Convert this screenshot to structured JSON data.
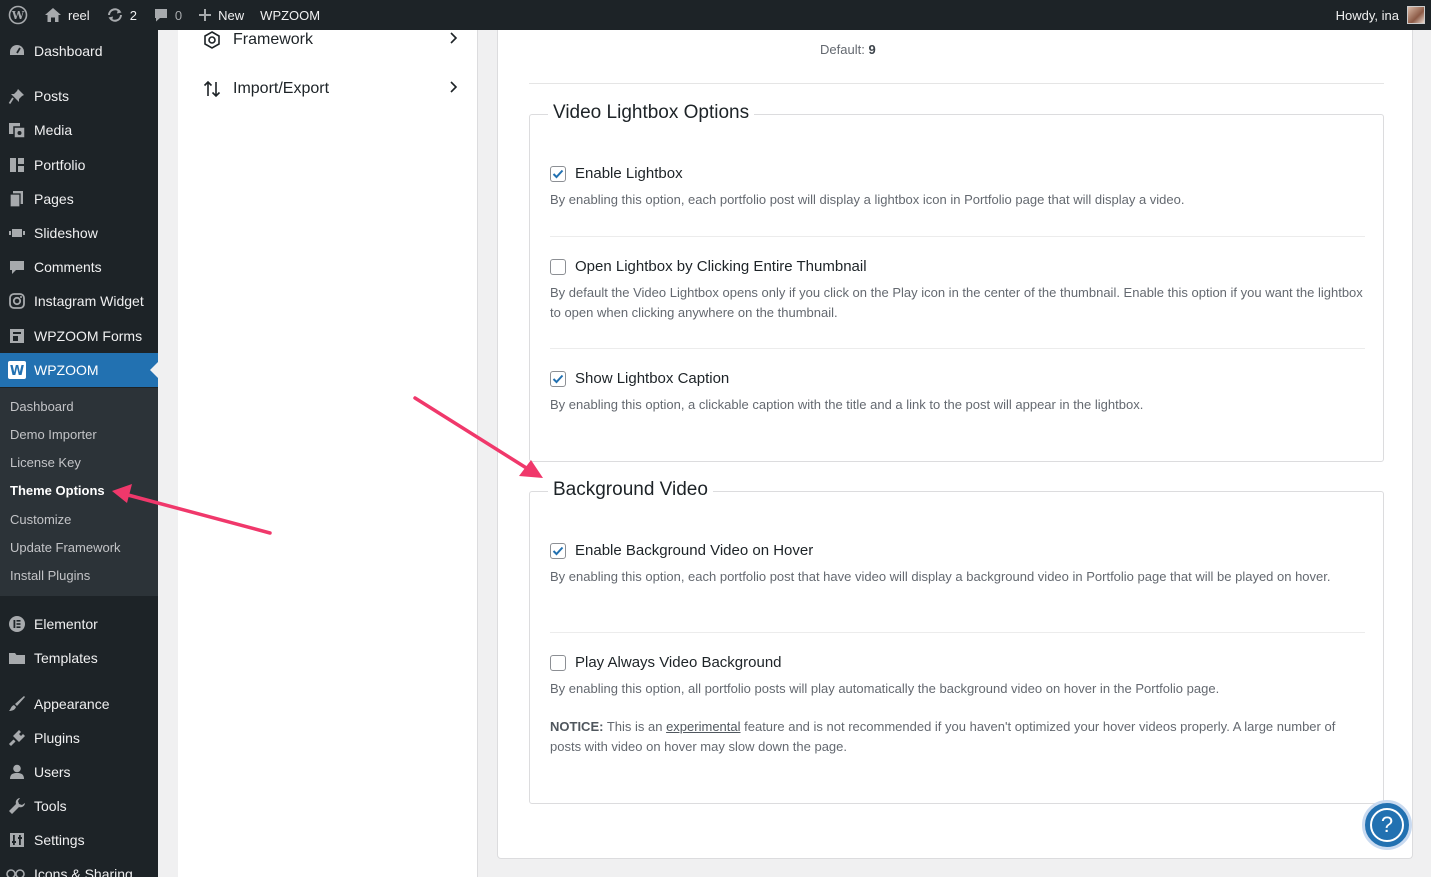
{
  "adminbar": {
    "site_name": "reel",
    "updates_count": "2",
    "comments_count": "0",
    "new_label": "New",
    "wpzoom_label": "WPZOOM",
    "howdy": "Howdy, ina"
  },
  "sidebar": {
    "items": [
      {
        "label": "Dashboard",
        "icon": "dashboard-icon"
      },
      {
        "label": "Posts",
        "icon": "pin-icon"
      },
      {
        "label": "Media",
        "icon": "media-icon"
      },
      {
        "label": "Portfolio",
        "icon": "portfolio-icon"
      },
      {
        "label": "Pages",
        "icon": "pages-icon"
      },
      {
        "label": "Slideshow",
        "icon": "slideshow-icon"
      },
      {
        "label": "Comments",
        "icon": "comments-icon"
      },
      {
        "label": "Instagram Widget",
        "icon": "instagram-icon"
      },
      {
        "label": "WPZOOM Forms",
        "icon": "forms-icon"
      },
      {
        "label": "WPZOOM",
        "icon": "wpzoom-icon"
      },
      {
        "label": "Elementor",
        "icon": "elementor-icon"
      },
      {
        "label": "Templates",
        "icon": "folder-icon"
      },
      {
        "label": "Appearance",
        "icon": "brush-icon"
      },
      {
        "label": "Plugins",
        "icon": "plugin-icon"
      },
      {
        "label": "Users",
        "icon": "user-icon"
      },
      {
        "label": "Tools",
        "icon": "wrench-icon"
      },
      {
        "label": "Settings",
        "icon": "settings-icon"
      },
      {
        "label": "Icons & Sharing",
        "icon": "share-icon"
      }
    ],
    "submenu": [
      {
        "label": "Dashboard"
      },
      {
        "label": "Demo Importer"
      },
      {
        "label": "License Key"
      },
      {
        "label": "Theme Options"
      },
      {
        "label": "Customize"
      },
      {
        "label": "Update Framework"
      },
      {
        "label": "Install Plugins"
      }
    ]
  },
  "options_nav": {
    "items": [
      {
        "label": "Framework",
        "icon": "framework-icon"
      },
      {
        "label": "Import/Export",
        "icon": "import-export-icon"
      }
    ]
  },
  "main": {
    "default_label": "Default:",
    "default_value": "9",
    "video_lightbox": {
      "title": "Video Lightbox Options",
      "options": [
        {
          "label": "Enable Lightbox",
          "checked": true,
          "desc": "By enabling this option, each portfolio post will display a lightbox icon in Portfolio page that will display a video."
        },
        {
          "label": "Open Lightbox by Clicking Entire Thumbnail",
          "checked": false,
          "desc": "By default the Video Lightbox opens only if you click on the Play icon in the center of the thumbnail. Enable this option if you want the lightbox to open when clicking anywhere on the thumbnail."
        },
        {
          "label": "Show Lightbox Caption",
          "checked": true,
          "desc": "By enabling this option, a clickable caption with the title and a link to the post will appear in the lightbox."
        }
      ]
    },
    "background_video": {
      "title": "Background Video",
      "options": [
        {
          "label": "Enable Background Video on Hover",
          "checked": true,
          "desc": "By enabling this option, each portfolio post that have video will display a background video in Portfolio page that will be played on hover."
        },
        {
          "label": "Play Always Video Background",
          "checked": false,
          "desc": "By enabling this option, all portfolio posts will play automatically the background video on hover in the Portfolio page."
        }
      ],
      "notice_label": "NOTICE:",
      "notice_pre": " This is an ",
      "notice_link": "experimental",
      "notice_post": " feature and is not recommended if you haven't optimized your hover videos properly. A large number of posts with video on hover may slow down the page."
    }
  },
  "help": {
    "label": "?"
  },
  "colors": {
    "accent": "#2271b1",
    "annotation_arrow": "#f0386b",
    "admin_dark": "#1d2327"
  }
}
